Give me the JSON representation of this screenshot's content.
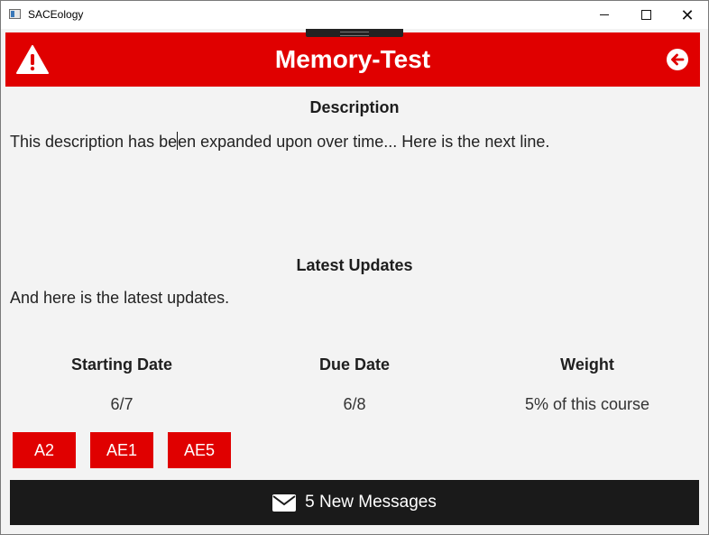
{
  "window": {
    "title": "SACEology"
  },
  "header": {
    "title": "Memory-Test",
    "bg_color": "#e00000"
  },
  "description": {
    "heading": "Description",
    "text_before_caret": "This description has be",
    "text_after_caret": "en expanded upon over time... Here is the next line."
  },
  "updates": {
    "heading": "Latest Updates",
    "text": "And here is the latest updates."
  },
  "details": {
    "starting_date_label": "Starting Date",
    "starting_date_value": "6/7",
    "due_date_label": "Due Date",
    "due_date_value": "6/8",
    "weight_label": "Weight",
    "weight_value": "5% of this course"
  },
  "tags": [
    "A2",
    "AE1",
    "AE5"
  ],
  "messages": {
    "label": "5 New Messages",
    "icon": "mail-icon"
  },
  "icons": {
    "warning": "warning-icon",
    "back": "back-arrow-icon"
  }
}
